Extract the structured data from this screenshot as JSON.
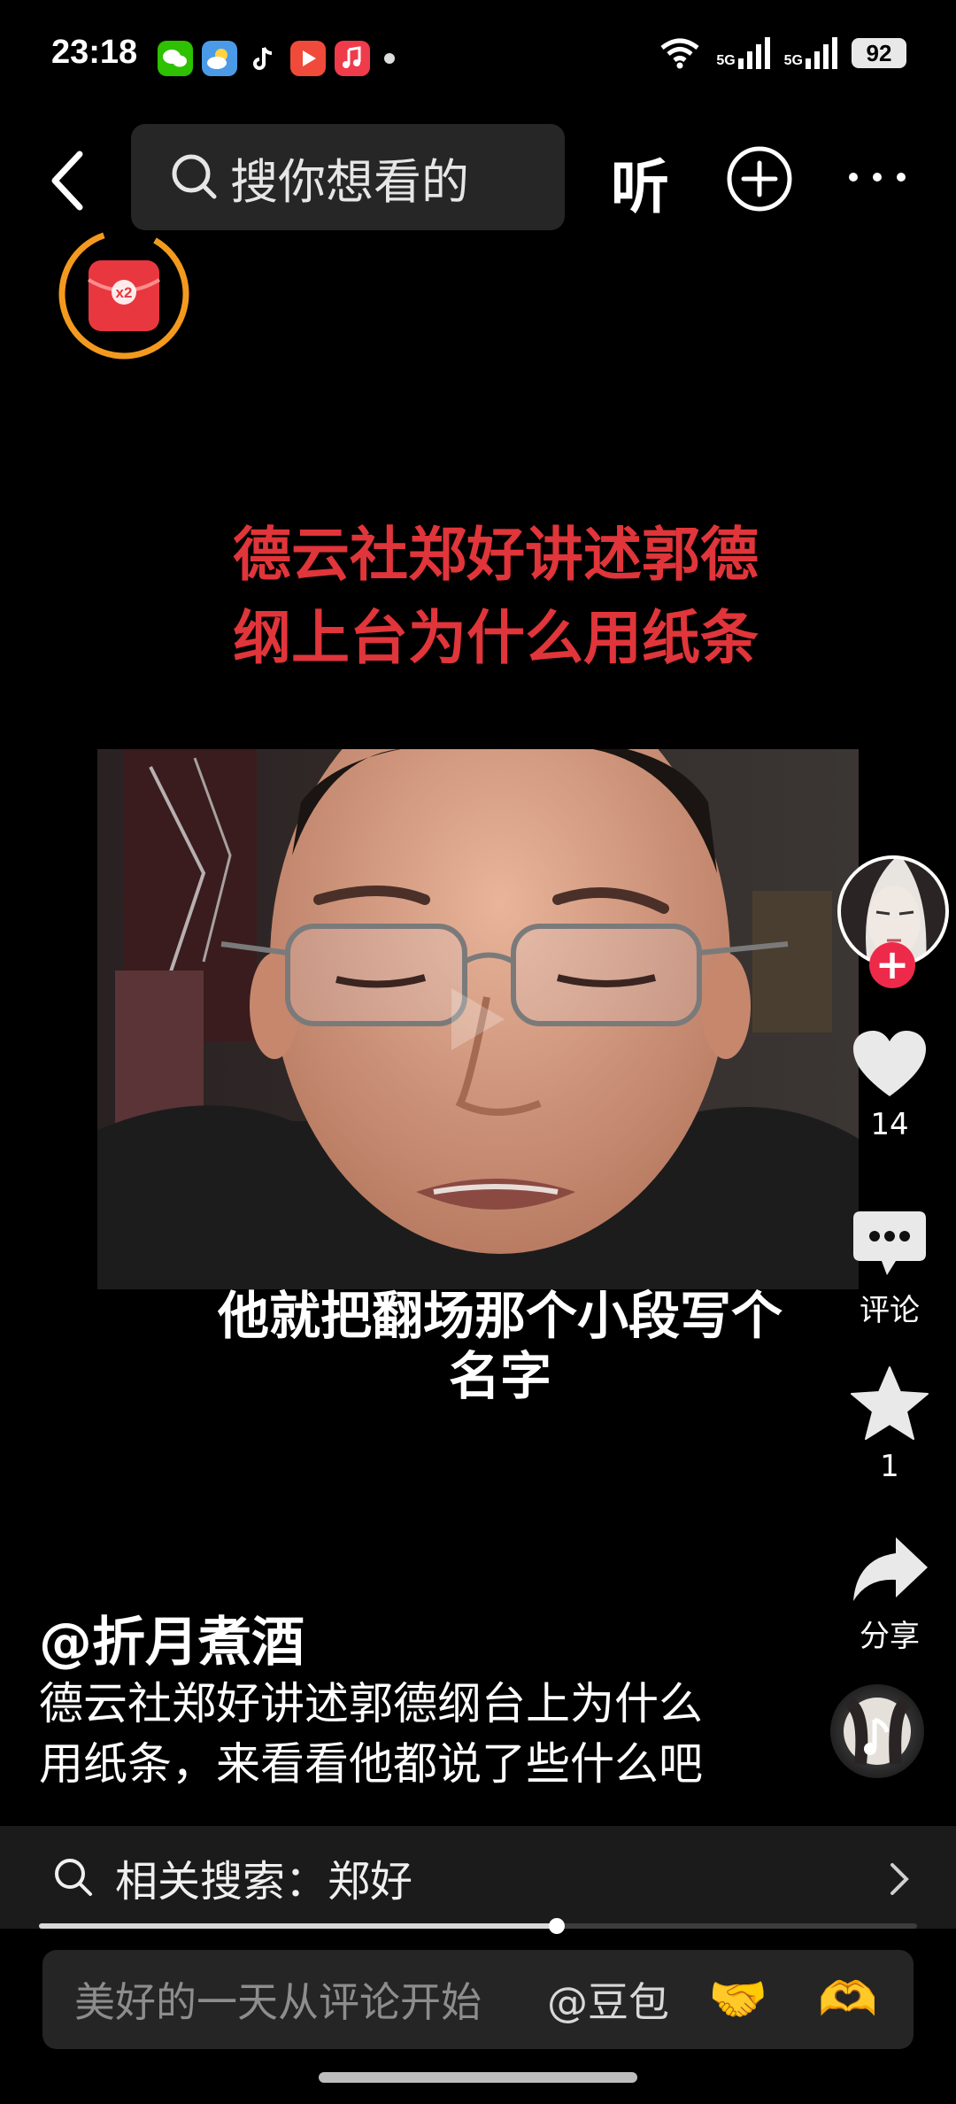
{
  "status_bar": {
    "time": "23:18",
    "network_label_1": "5G",
    "network_label_2": "5G",
    "battery": "92",
    "app_icons": [
      "wechat-icon",
      "weather-icon",
      "tiktok-icon",
      "video-icon",
      "music-icon"
    ]
  },
  "top_nav": {
    "search_placeholder": "搜你想看的",
    "listen_label": "听"
  },
  "red_packet": {
    "multiplier": "x2"
  },
  "video": {
    "title_line1": "德云社郑好讲述郭德",
    "title_line2": "纲上台为什么用纸条",
    "subtitle_line1": "他就把翻场那个小段写个",
    "subtitle_line2": "名字"
  },
  "actions": {
    "likes": "14",
    "comment_label": "评论",
    "favorites": "1",
    "share_label": "分享"
  },
  "post": {
    "author": "@折月煮酒",
    "description_line1": "德云社郑好讲述郭德纲台上为什么",
    "description_line2": "用纸条，来看看他都说了些什么吧"
  },
  "related_search": {
    "text": "相关搜索：郑好"
  },
  "progress": {
    "fraction": 0.59
  },
  "comment_bar": {
    "placeholder": "美好的一天从评论开始",
    "mention": "@豆包",
    "emoji_1": "🤝",
    "emoji_2": "🫶"
  },
  "colors": {
    "title_red": "#e0353a",
    "follow_red": "#ee2a4a",
    "ring_orange": "#f39a1e"
  }
}
